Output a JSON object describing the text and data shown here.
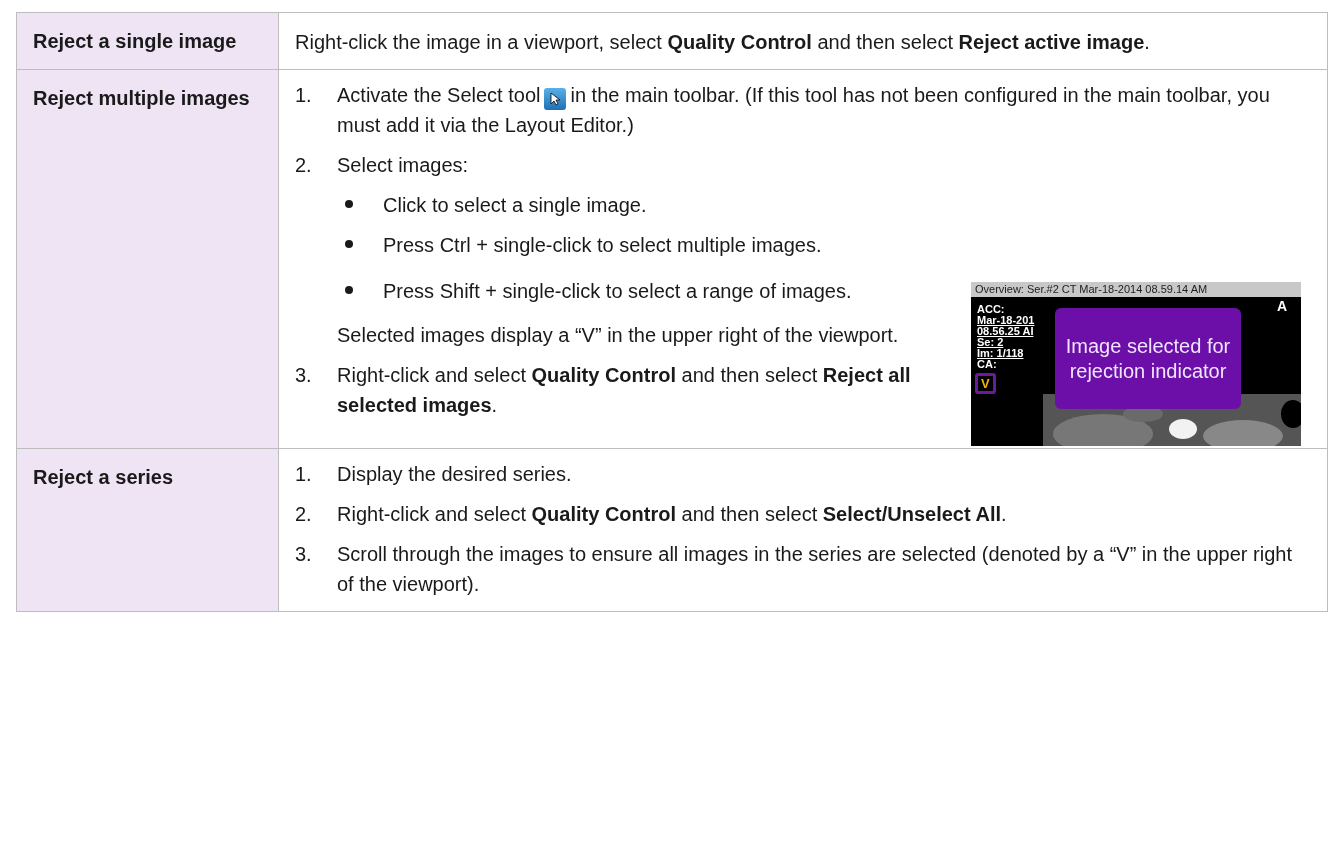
{
  "rows": [
    {
      "label": "Reject a single image",
      "kind": "text",
      "text": "Right-click the image in a viewport, select **Quality Control** and then select **Reject active image**."
    },
    {
      "label": "Reject multiple images",
      "kind": "steps",
      "steps": [
        {
          "number": "1.",
          "text_before": "Activate the Select tool",
          "tool_icon": true,
          "text_after": "in the main toolbar. (If this tool has not been configured in the main toolbar, you must add it via the Layout Editor.)"
        },
        {
          "number": "2.",
          "text_before": "Select images:",
          "bullets": [
            "Click to select a single image.",
            "Press Ctrl + single-click to select multiple images.",
            "Press Shift + single-click to select a range of images."
          ],
          "note": "Selected images display a “V” in the upper right of the viewport.",
          "figure": {
            "title": "Overview: Ser.#2  CT Mar-18-2014 08.59.14 AM",
            "overlay_lines": [
              "ACC:",
              "Mar-18-201",
              "08.56.25 AI",
              "Se: 2",
              "Im: 1/118",
              "CA:"
            ],
            "orientation": "A",
            "marker": "V",
            "callout": "Image selected for rejection indicator"
          }
        },
        {
          "number": "3.",
          "text_before": "Right-click and select **Quality Control** and then select **Reject all selected images**."
        }
      ]
    },
    {
      "label": "Reject a series",
      "kind": "steps",
      "steps": [
        {
          "number": "1.",
          "text_before": "Display the desired series."
        },
        {
          "number": "2.",
          "text_before": "Right-click and select **Quality Control** and then select **Select/Unselect All**."
        },
        {
          "number": "3.",
          "text_before": "Scroll through the images to ensure all images in the series are selected (denoted by a “V” in the upper right of the viewport)."
        }
      ]
    }
  ]
}
